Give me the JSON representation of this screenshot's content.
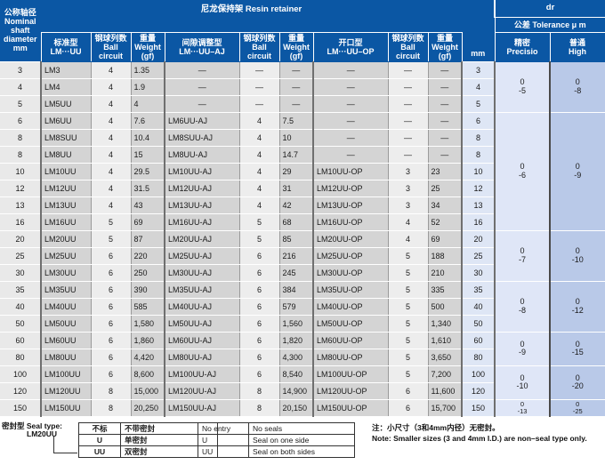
{
  "header": {
    "title": "尼龙保持架  Resin retainer",
    "nominal": {
      "cn": "公称轴径",
      "en1": "Nominal",
      "en2": "shaft",
      "en3": "diameter",
      "en4": "mm"
    },
    "groups": [
      {
        "cn": "标准型",
        "en": "LM···UU"
      },
      {
        "cn": "间隙调整型",
        "en": "LM···UU–AJ"
      },
      {
        "cn": "开口型",
        "en": "LM···UU–OP"
      }
    ],
    "ball": {
      "cn": "钢球列数",
      "en1": "Ball",
      "en2": "circuit"
    },
    "weight": {
      "cn": "重量",
      "en1": "Weight",
      "en2": "(gf)"
    },
    "mm": "mm",
    "dr": "dr",
    "tolerance_band": "公差 Tolerance μ m",
    "precision": {
      "cn": "精密",
      "en": "Precisio"
    },
    "high": {
      "cn": "普通",
      "en": "High"
    }
  },
  "rows": [
    {
      "nom": "3",
      "std": "LM3",
      "sb": "4",
      "sw": "1.35",
      "aj": "—",
      "ab": "—",
      "aw": "—",
      "op": "—",
      "ob": "—",
      "ow": "—",
      "mm": "3"
    },
    {
      "nom": "4",
      "std": "LM4",
      "sb": "4",
      "sw": "1.9",
      "aj": "—",
      "ab": "—",
      "aw": "—",
      "op": "—",
      "ob": "—",
      "ow": "—",
      "mm": "4"
    },
    {
      "nom": "5",
      "std": "LM5UU",
      "sb": "4",
      "sw": "4",
      "aj": "—",
      "ab": "—",
      "aw": "—",
      "op": "—",
      "ob": "—",
      "ow": "—",
      "mm": "5"
    },
    {
      "nom": "6",
      "std": "LM6UU",
      "sb": "4",
      "sw": "7.6",
      "aj": "LM6UU-AJ",
      "ab": "4",
      "aw": "7.5",
      "op": "—",
      "ob": "—",
      "ow": "—",
      "mm": "6"
    },
    {
      "nom": "8",
      "std": "LM8SUU",
      "sb": "4",
      "sw": "10.4",
      "aj": "LM8SUU-AJ",
      "ab": "4",
      "aw": "10",
      "op": "—",
      "ob": "—",
      "ow": "—",
      "mm": "8"
    },
    {
      "nom": "8",
      "std": "LM8UU",
      "sb": "4",
      "sw": "15",
      "aj": "LM8UU-AJ",
      "ab": "4",
      "aw": "14.7",
      "op": "—",
      "ob": "—",
      "ow": "—",
      "mm": "8"
    },
    {
      "nom": "10",
      "std": "LM10UU",
      "sb": "4",
      "sw": "29.5",
      "aj": "LM10UU-AJ",
      "ab": "4",
      "aw": "29",
      "op": "LM10UU-OP",
      "ob": "3",
      "ow": "23",
      "mm": "10"
    },
    {
      "nom": "12",
      "std": "LM12UU",
      "sb": "4",
      "sw": "31.5",
      "aj": "LM12UU-AJ",
      "ab": "4",
      "aw": "31",
      "op": "LM12UU-OP",
      "ob": "3",
      "ow": "25",
      "mm": "12"
    },
    {
      "nom": "13",
      "std": "LM13UU",
      "sb": "4",
      "sw": "43",
      "aj": "LM13UU-AJ",
      "ab": "4",
      "aw": "42",
      "op": "LM13UU-OP",
      "ob": "3",
      "ow": "34",
      "mm": "13"
    },
    {
      "nom": "16",
      "std": "LM16UU",
      "sb": "5",
      "sw": "69",
      "aj": "LM16UU-AJ",
      "ab": "5",
      "aw": "68",
      "op": "LM16UU-OP",
      "ob": "4",
      "ow": "52",
      "mm": "16"
    },
    {
      "nom": "20",
      "std": "LM20UU",
      "sb": "5",
      "sw": "87",
      "aj": "LM20UU-AJ",
      "ab": "5",
      "aw": "85",
      "op": "LM20UU-OP",
      "ob": "4",
      "ow": "69",
      "mm": "20"
    },
    {
      "nom": "25",
      "std": "LM25UU",
      "sb": "6",
      "sw": "220",
      "aj": "LM25UU-AJ",
      "ab": "6",
      "aw": "216",
      "op": "LM25UU-OP",
      "ob": "5",
      "ow": "188",
      "mm": "25"
    },
    {
      "nom": "30",
      "std": "LM30UU",
      "sb": "6",
      "sw": "250",
      "aj": "LM30UU-AJ",
      "ab": "6",
      "aw": "245",
      "op": "LM30UU-OP",
      "ob": "5",
      "ow": "210",
      "mm": "30"
    },
    {
      "nom": "35",
      "std": "LM35UU",
      "sb": "6",
      "sw": "390",
      "aj": "LM35UU-AJ",
      "ab": "6",
      "aw": "384",
      "op": "LM35UU-OP",
      "ob": "5",
      "ow": "335",
      "mm": "35"
    },
    {
      "nom": "40",
      "std": "LM40UU",
      "sb": "6",
      "sw": "585",
      "aj": "LM40UU-AJ",
      "ab": "6",
      "aw": "579",
      "op": "LM40UU-OP",
      "ob": "5",
      "ow": "500",
      "mm": "40"
    },
    {
      "nom": "50",
      "std": "LM50UU",
      "sb": "6",
      "sw": "1,580",
      "aj": "LM50UU-AJ",
      "ab": "6",
      "aw": "1,560",
      "op": "LM50UU-OP",
      "ob": "5",
      "ow": "1,340",
      "mm": "50"
    },
    {
      "nom": "60",
      "std": "LM60UU",
      "sb": "6",
      "sw": "1,860",
      "aj": "LM60UU-AJ",
      "ab": "6",
      "aw": "1,820",
      "op": "LM60UU-OP",
      "ob": "5",
      "ow": "1,610",
      "mm": "60"
    },
    {
      "nom": "80",
      "std": "LM80UU",
      "sb": "6",
      "sw": "4,420",
      "aj": "LM80UU-AJ",
      "ab": "6",
      "aw": "4,300",
      "op": "LM80UU-OP",
      "ob": "5",
      "ow": "3,650",
      "mm": "80"
    },
    {
      "nom": "100",
      "std": "LM100UU",
      "sb": "6",
      "sw": "8,600",
      "aj": "LM100UU-AJ",
      "ab": "6",
      "aw": "8,540",
      "op": "LM100UU-OP",
      "ob": "5",
      "ow": "7,200",
      "mm": "100"
    },
    {
      "nom": "120",
      "std": "LM120UU",
      "sb": "8",
      "sw": "15,000",
      "aj": "LM120UU-AJ",
      "ab": "8",
      "aw": "14,900",
      "op": "LM120UU-OP",
      "ob": "6",
      "ow": "11,600",
      "mm": "120"
    },
    {
      "nom": "150",
      "std": "LM150UU",
      "sb": "8",
      "sw": "20,250",
      "aj": "LM150UU-AJ",
      "ab": "8",
      "aw": "20,150",
      "op": "LM150UU-OP",
      "ob": "6",
      "ow": "15,700",
      "mm": "150"
    }
  ],
  "tolerance_groups": [
    {
      "span": 3,
      "precision_hi": "0",
      "precision_lo": "-5",
      "high_hi": "0",
      "high_lo": "-8",
      "small": false
    },
    {
      "span": 7,
      "precision_hi": "0",
      "precision_lo": "-6",
      "high_hi": "0",
      "high_lo": "-9",
      "small": false
    },
    {
      "span": 3,
      "precision_hi": "0",
      "precision_lo": "-7",
      "high_hi": "0",
      "high_lo": "-10",
      "small": false
    },
    {
      "span": 3,
      "precision_hi": "0",
      "precision_lo": "-8",
      "high_hi": "0",
      "high_lo": "-12",
      "small": false
    },
    {
      "span": 2,
      "precision_hi": "0",
      "precision_lo": "-9",
      "high_hi": "0",
      "high_lo": "-15",
      "small": false
    },
    {
      "span": 2,
      "precision_hi": "0",
      "precision_lo": "-10",
      "high_hi": "0",
      "high_lo": "-20",
      "small": false
    },
    {
      "span": 1,
      "precision_hi": "0",
      "precision_lo": "-13",
      "high_hi": "0",
      "high_lo": "-25",
      "small": true
    }
  ],
  "footer": {
    "seal_label": "密封型 Seal type:",
    "seal_model": "LM20UU",
    "legend_cn": [
      {
        "key": "不标",
        "value": "不带密封"
      },
      {
        "key": "U",
        "value": "单密封"
      },
      {
        "key": "UU",
        "value": "双密封"
      }
    ],
    "legend_en": [
      {
        "key": "No entry",
        "value": "No seals"
      },
      {
        "key": "U",
        "value": "Seal on one side"
      },
      {
        "key": "UU",
        "value": "Seal on both sides"
      }
    ],
    "note_cn": "注：小尺寸（3和4mm内径）无密封。",
    "note_en": "Note: Smaller sizes (3 and 4mm I.D.) are non–seal type only."
  },
  "colors": {
    "header_blue": "#0b57a4",
    "nominal_gray": "#e9e9e9",
    "model_gray": "#d4d4d4",
    "ball_gray": "#ededed",
    "mm_blue": "#dee6f5",
    "precision_blue": "#dfe6f7",
    "high_blue": "#b9c9e8"
  }
}
